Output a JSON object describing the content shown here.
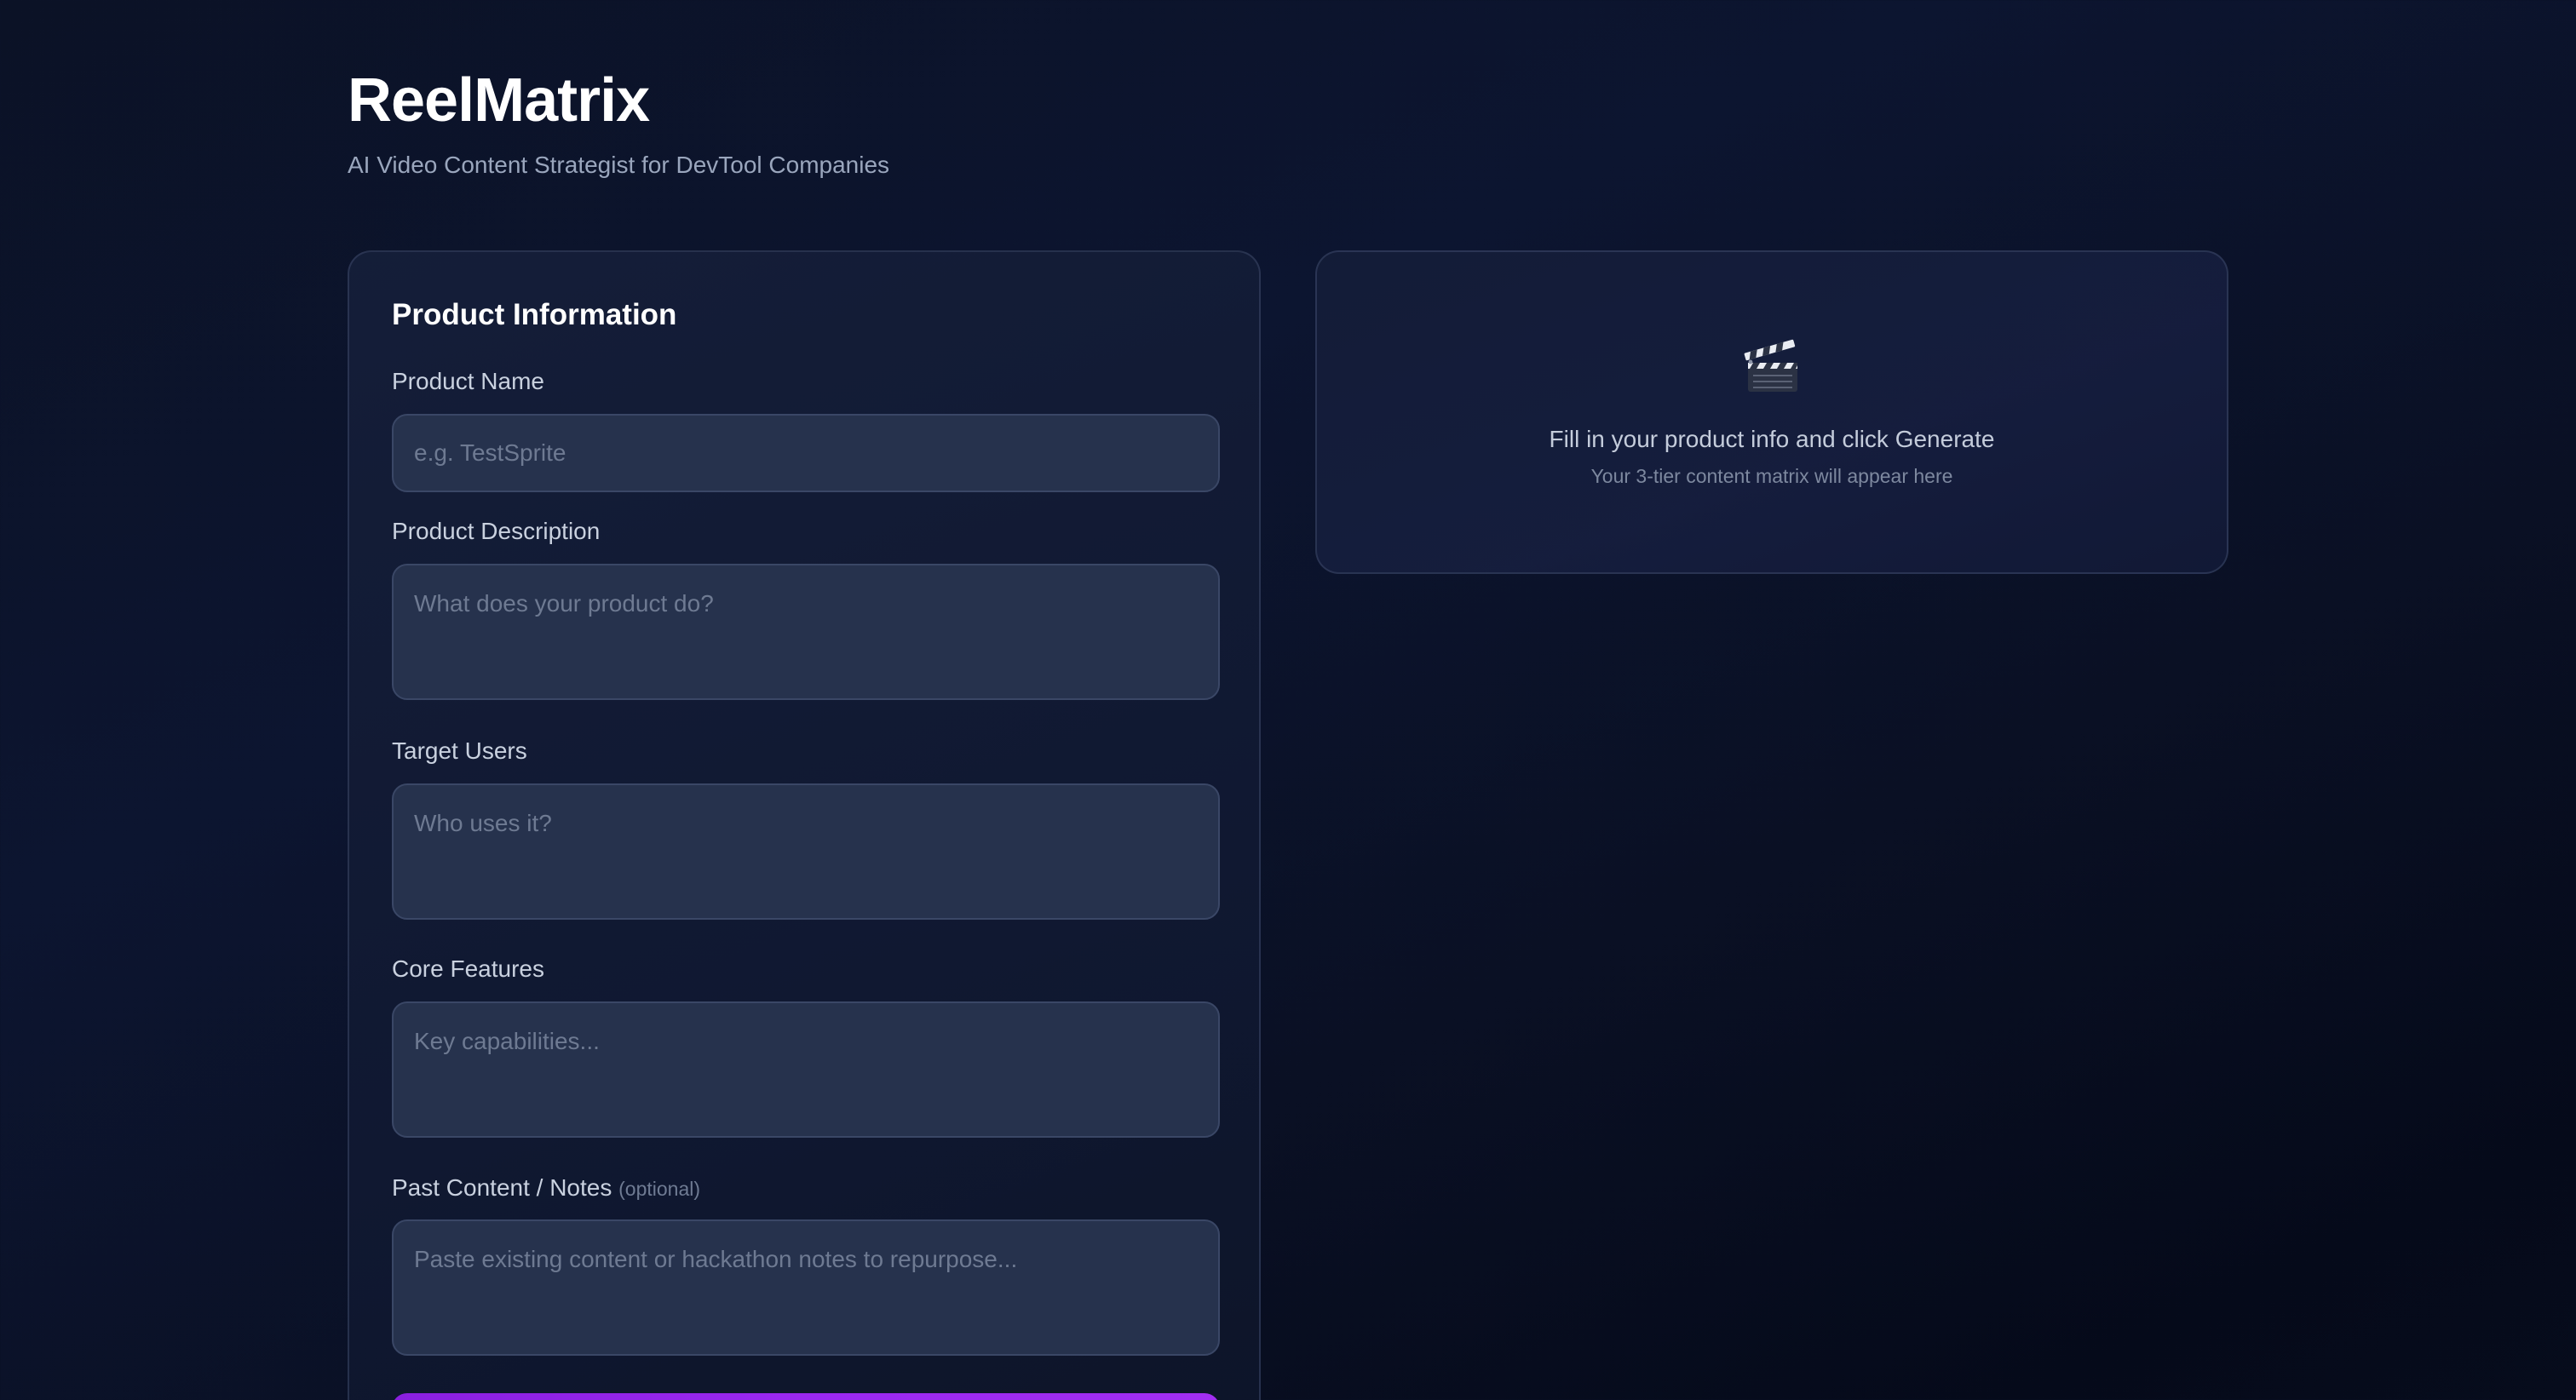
{
  "header": {
    "title": "ReelMatrix",
    "subtitle": "AI Video Content Strategist for DevTool Companies"
  },
  "form": {
    "section_title": "Product Information",
    "product_name": {
      "label": "Product Name",
      "value": "",
      "placeholder": "e.g. TestSprite"
    },
    "product_description": {
      "label": "Product Description",
      "value": "",
      "placeholder": "What does your product do?"
    },
    "target_users": {
      "label": "Target Users",
      "value": "",
      "placeholder": "Who uses it?"
    },
    "core_features": {
      "label": "Core Features",
      "value": "",
      "placeholder": "Key capabilities..."
    },
    "past_content": {
      "label": "Past Content / Notes",
      "optional_tag": "(optional)",
      "value": "",
      "placeholder": "Paste existing content or hackathon notes to repurpose..."
    },
    "generate_button": {
      "label": "",
      "color": "#9b28f0"
    }
  },
  "output": {
    "icon": "clapperboard-icon",
    "empty_title": "Fill in your product info and click Generate",
    "empty_subtitle": "Your 3-tier content matrix will appear here"
  },
  "colors": {
    "background": "#0b1226",
    "card": "#161f3a",
    "field": "#26324d",
    "accent": "#9b28f0"
  }
}
